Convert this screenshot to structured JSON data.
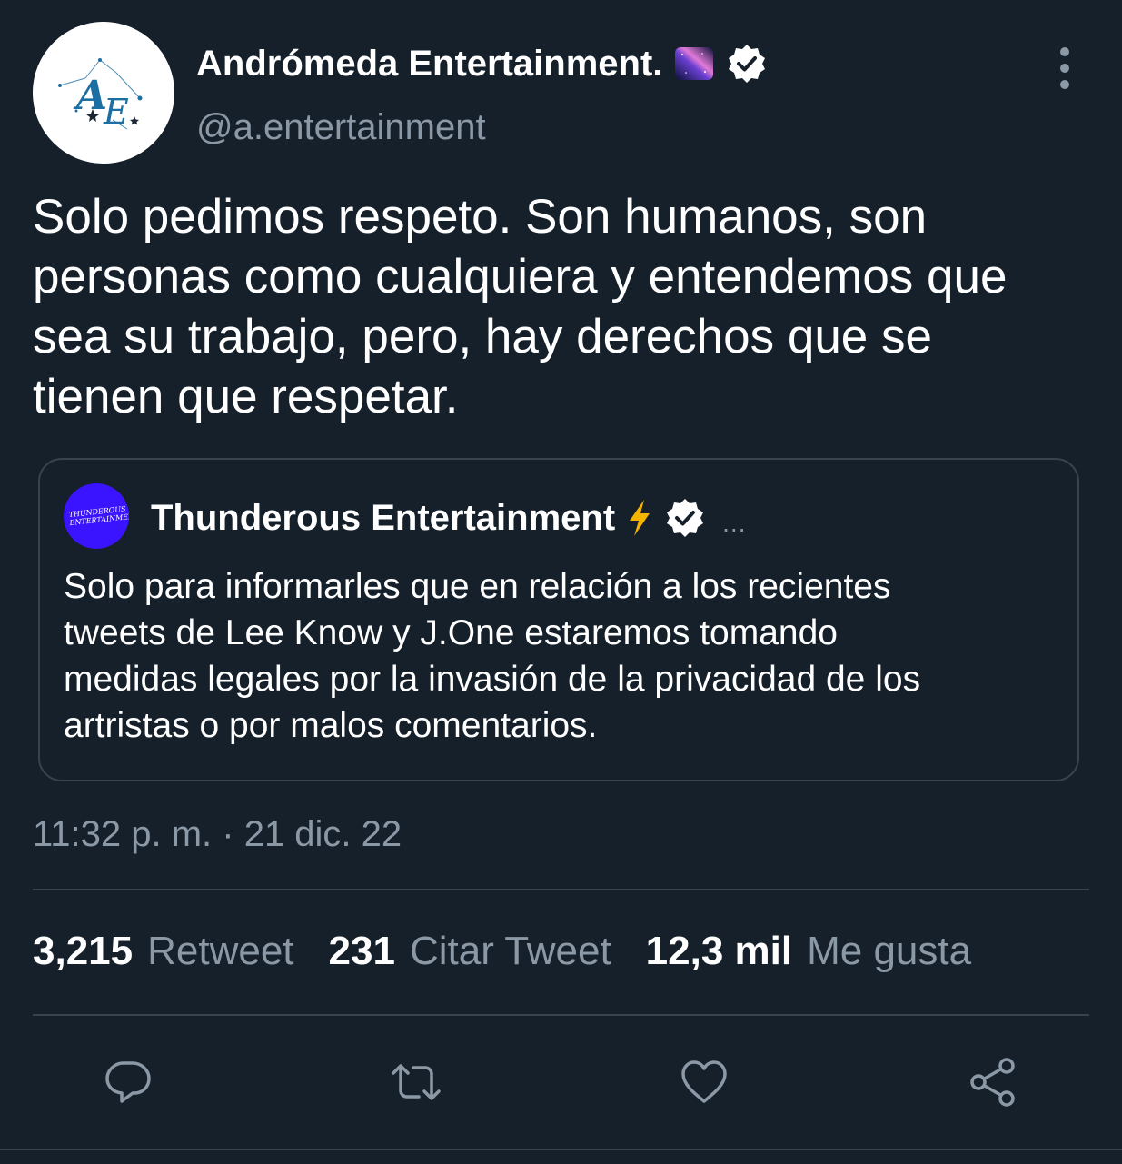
{
  "tweet": {
    "author": {
      "display_name": "Andrómeda Entertainment.",
      "handle": "@a.entertainment",
      "avatar_monogram": "AE",
      "name_emoji": "galaxy-emoji",
      "verified_icon": "verified-badge-icon"
    },
    "more_icon": "more-vertical-icon",
    "text_lines": [
      "Solo pedimos respeto. Son humanos, son",
      "personas como cualquiera y entendemos que",
      "sea su trabajo, pero, hay derechos que se",
      "tienen que respetar."
    ],
    "quoted": {
      "display_name": "Thunderous Entertainment",
      "avatar_text": "THUNDEROUS ENTERTAINMENT",
      "name_emoji": "lightning-bolt-icon",
      "more_label": "...",
      "text_lines": [
        "Solo para informarles que en relación a los recientes",
        "tweets de Lee Know y J.One estaremos tomando",
        "medidas legales por la invasión de la privacidad de los",
        "artristas o por malos comentarios."
      ]
    },
    "timestamp": "11:32 p. m. · 21 dic. 22",
    "stats": {
      "retweets": {
        "value": "3,215",
        "label": "Retweet"
      },
      "quotes": {
        "value": "231",
        "label": "Citar Tweet"
      },
      "likes": {
        "value": "12,3 mil",
        "label": "Me gusta"
      }
    },
    "actions": [
      "reply-icon",
      "retweet-icon",
      "like-icon",
      "share-icon"
    ]
  },
  "colors": {
    "background": "#15202b",
    "text_primary": "#ffffff",
    "text_secondary": "#8b98a5",
    "border": "#38444d",
    "verified": "#ffffff",
    "avatar_brand": "#1d6fa3",
    "quote_avatar_bg": "#3b14ff",
    "bolt": "#f4b400"
  }
}
